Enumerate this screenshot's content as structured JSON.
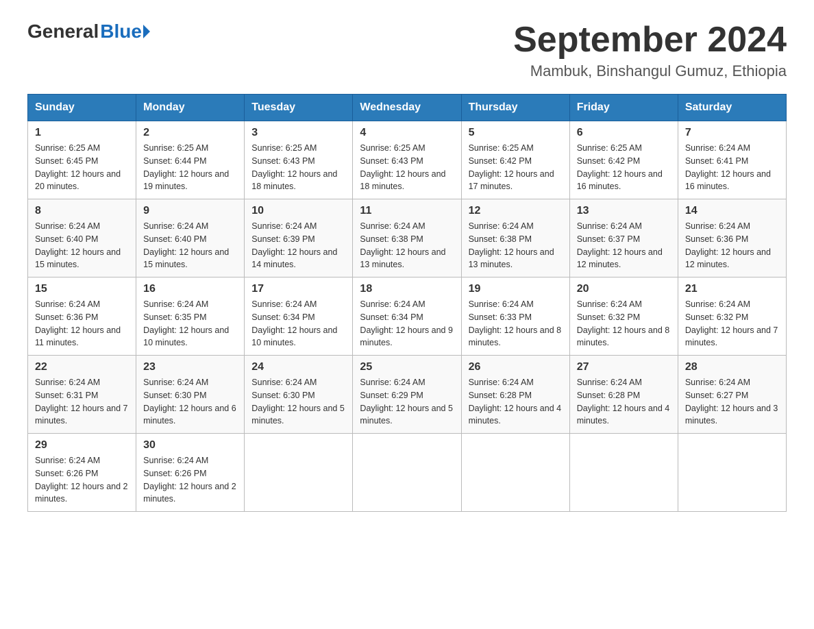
{
  "logo": {
    "general": "General",
    "blue": "Blue"
  },
  "header": {
    "month": "September 2024",
    "location": "Mambuk, Binshangul Gumuz, Ethiopia"
  },
  "weekdays": [
    "Sunday",
    "Monday",
    "Tuesday",
    "Wednesday",
    "Thursday",
    "Friday",
    "Saturday"
  ],
  "weeks": [
    [
      {
        "day": "1",
        "sunrise": "6:25 AM",
        "sunset": "6:45 PM",
        "daylight": "12 hours and 20 minutes."
      },
      {
        "day": "2",
        "sunrise": "6:25 AM",
        "sunset": "6:44 PM",
        "daylight": "12 hours and 19 minutes."
      },
      {
        "day": "3",
        "sunrise": "6:25 AM",
        "sunset": "6:43 PM",
        "daylight": "12 hours and 18 minutes."
      },
      {
        "day": "4",
        "sunrise": "6:25 AM",
        "sunset": "6:43 PM",
        "daylight": "12 hours and 18 minutes."
      },
      {
        "day": "5",
        "sunrise": "6:25 AM",
        "sunset": "6:42 PM",
        "daylight": "12 hours and 17 minutes."
      },
      {
        "day": "6",
        "sunrise": "6:25 AM",
        "sunset": "6:42 PM",
        "daylight": "12 hours and 16 minutes."
      },
      {
        "day": "7",
        "sunrise": "6:24 AM",
        "sunset": "6:41 PM",
        "daylight": "12 hours and 16 minutes."
      }
    ],
    [
      {
        "day": "8",
        "sunrise": "6:24 AM",
        "sunset": "6:40 PM",
        "daylight": "12 hours and 15 minutes."
      },
      {
        "day": "9",
        "sunrise": "6:24 AM",
        "sunset": "6:40 PM",
        "daylight": "12 hours and 15 minutes."
      },
      {
        "day": "10",
        "sunrise": "6:24 AM",
        "sunset": "6:39 PM",
        "daylight": "12 hours and 14 minutes."
      },
      {
        "day": "11",
        "sunrise": "6:24 AM",
        "sunset": "6:38 PM",
        "daylight": "12 hours and 13 minutes."
      },
      {
        "day": "12",
        "sunrise": "6:24 AM",
        "sunset": "6:38 PM",
        "daylight": "12 hours and 13 minutes."
      },
      {
        "day": "13",
        "sunrise": "6:24 AM",
        "sunset": "6:37 PM",
        "daylight": "12 hours and 12 minutes."
      },
      {
        "day": "14",
        "sunrise": "6:24 AM",
        "sunset": "6:36 PM",
        "daylight": "12 hours and 12 minutes."
      }
    ],
    [
      {
        "day": "15",
        "sunrise": "6:24 AM",
        "sunset": "6:36 PM",
        "daylight": "12 hours and 11 minutes."
      },
      {
        "day": "16",
        "sunrise": "6:24 AM",
        "sunset": "6:35 PM",
        "daylight": "12 hours and 10 minutes."
      },
      {
        "day": "17",
        "sunrise": "6:24 AM",
        "sunset": "6:34 PM",
        "daylight": "12 hours and 10 minutes."
      },
      {
        "day": "18",
        "sunrise": "6:24 AM",
        "sunset": "6:34 PM",
        "daylight": "12 hours and 9 minutes."
      },
      {
        "day": "19",
        "sunrise": "6:24 AM",
        "sunset": "6:33 PM",
        "daylight": "12 hours and 8 minutes."
      },
      {
        "day": "20",
        "sunrise": "6:24 AM",
        "sunset": "6:32 PM",
        "daylight": "12 hours and 8 minutes."
      },
      {
        "day": "21",
        "sunrise": "6:24 AM",
        "sunset": "6:32 PM",
        "daylight": "12 hours and 7 minutes."
      }
    ],
    [
      {
        "day": "22",
        "sunrise": "6:24 AM",
        "sunset": "6:31 PM",
        "daylight": "12 hours and 7 minutes."
      },
      {
        "day": "23",
        "sunrise": "6:24 AM",
        "sunset": "6:30 PM",
        "daylight": "12 hours and 6 minutes."
      },
      {
        "day": "24",
        "sunrise": "6:24 AM",
        "sunset": "6:30 PM",
        "daylight": "12 hours and 5 minutes."
      },
      {
        "day": "25",
        "sunrise": "6:24 AM",
        "sunset": "6:29 PM",
        "daylight": "12 hours and 5 minutes."
      },
      {
        "day": "26",
        "sunrise": "6:24 AM",
        "sunset": "6:28 PM",
        "daylight": "12 hours and 4 minutes."
      },
      {
        "day": "27",
        "sunrise": "6:24 AM",
        "sunset": "6:28 PM",
        "daylight": "12 hours and 4 minutes."
      },
      {
        "day": "28",
        "sunrise": "6:24 AM",
        "sunset": "6:27 PM",
        "daylight": "12 hours and 3 minutes."
      }
    ],
    [
      {
        "day": "29",
        "sunrise": "6:24 AM",
        "sunset": "6:26 PM",
        "daylight": "12 hours and 2 minutes."
      },
      {
        "day": "30",
        "sunrise": "6:24 AM",
        "sunset": "6:26 PM",
        "daylight": "12 hours and 2 minutes."
      },
      null,
      null,
      null,
      null,
      null
    ]
  ]
}
